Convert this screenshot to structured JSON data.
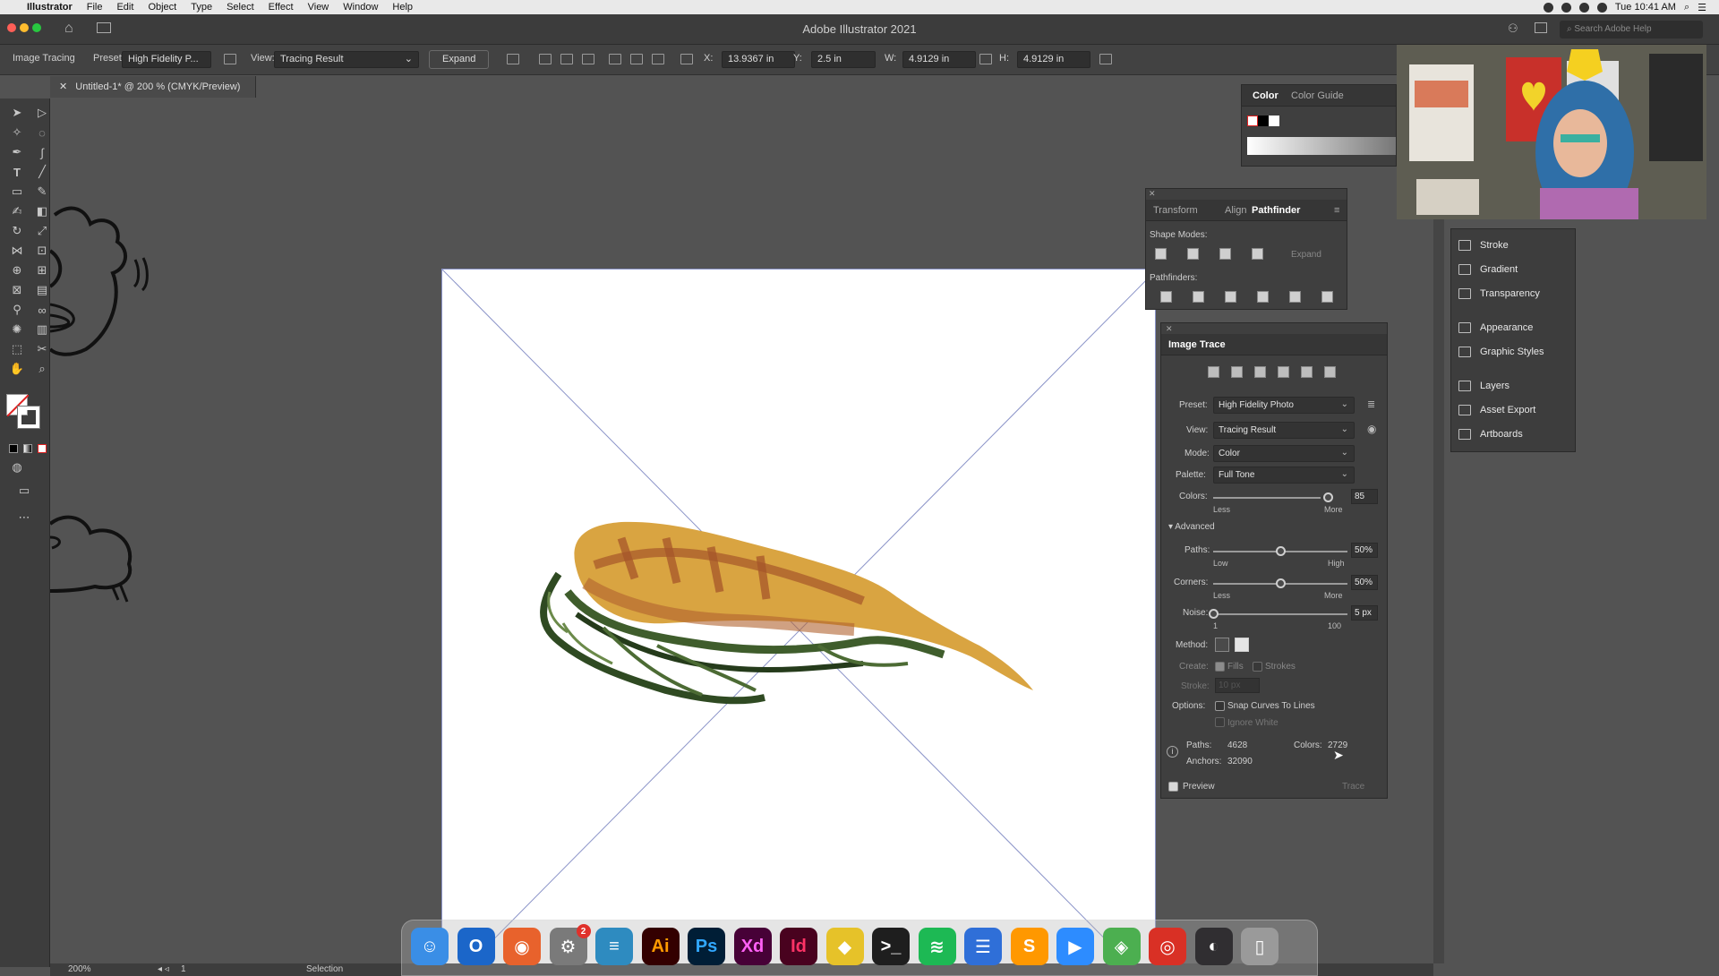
{
  "menubar": {
    "app_name": "Illustrator",
    "items": [
      "File",
      "Edit",
      "Object",
      "Type",
      "Select",
      "Effect",
      "View",
      "Window",
      "Help"
    ],
    "clock": "Tue 10:41 AM",
    "right_icons": [
      "dropbox-icon",
      "wifi-icon",
      "volume-icon",
      "battery-icon",
      "search-icon",
      "control-center-icon"
    ]
  },
  "window": {
    "title": "Adobe Illustrator 2021",
    "search_placeholder": "Search Adobe Help"
  },
  "controlbar": {
    "panel_label": "Image Tracing",
    "preset_label": "Preset:",
    "preset_value": "High Fidelity P...",
    "view_label": "View:",
    "view_value": "Tracing Result",
    "expand_label": "Expand",
    "x_label": "X:",
    "x_value": "13.9367 in",
    "y_label": "Y:",
    "y_value": "2.5 in",
    "w_label": "W:",
    "w_value": "4.9129 in",
    "h_label": "H:",
    "h_value": "4.9129 in"
  },
  "document_tab": {
    "title": "Untitled-1* @ 200 % (CMYK/Preview)",
    "close_glyph": "✕"
  },
  "statusbar": {
    "zoom": "200%",
    "artboard_number": "1",
    "tool_name": "Selection"
  },
  "color_panel": {
    "tabs": [
      "Color",
      "Color Guide"
    ]
  },
  "pathfinder_panel": {
    "tabs": [
      "Transform",
      "Align",
      "Pathfinder"
    ],
    "shape_modes_label": "Shape Modes:",
    "expand_label": "Expand",
    "pathfinders_label": "Pathfinders:"
  },
  "image_trace": {
    "title": "Image Trace",
    "preset_label": "Preset:",
    "preset_value": "High Fidelity Photo",
    "view_label": "View:",
    "view_value": "Tracing Result",
    "mode_label": "Mode:",
    "mode_value": "Color",
    "palette_label": "Palette:",
    "palette_value": "Full Tone",
    "colors_label": "Colors:",
    "colors_value": "85",
    "colors_fraction": 0.85,
    "colors_min_label": "Less",
    "colors_max_label": "More",
    "advanced_label": "Advanced",
    "paths_label": "Paths:",
    "paths_value": "50%",
    "paths_fraction": 0.5,
    "paths_min_label": "Low",
    "paths_max_label": "High",
    "corners_label": "Corners:",
    "corners_value": "50%",
    "corners_fraction": 0.5,
    "corners_min_label": "Less",
    "corners_max_label": "More",
    "noise_label": "Noise:",
    "noise_value": "5 px",
    "noise_fraction": 0.0,
    "noise_min_label": "1",
    "noise_max_label": "100",
    "method_label": "Method:",
    "create_label": "Create:",
    "fills_label": "Fills",
    "strokes_label": "Strokes",
    "stroke_label": "Stroke:",
    "stroke_value": "10 px",
    "options_label": "Options:",
    "snap_label": "Snap Curves To Lines",
    "ignore_white_label": "Ignore White",
    "stats_paths_label": "Paths:",
    "stats_paths_value": "4628",
    "stats_colors_label": "Colors:",
    "stats_colors_value": "2729",
    "stats_anchors_label": "Anchors:",
    "stats_anchors_value": "32090",
    "preview_label": "Preview",
    "trace_label": "Trace"
  },
  "side_panels": {
    "items": [
      "Stroke",
      "Gradient",
      "Transparency",
      "Appearance",
      "Graphic Styles",
      "Layers",
      "Asset Export",
      "Artboards"
    ]
  },
  "dock": {
    "apps": [
      {
        "name": "finder",
        "glyph": "☺",
        "color": "#3a8ee6"
      },
      {
        "name": "outlook",
        "glyph": "O",
        "color": "#1b66c9"
      },
      {
        "name": "firefox",
        "glyph": "◉",
        "color": "#e8622c"
      },
      {
        "name": "system-preferences",
        "glyph": "⚙",
        "color": "#7a7a7a",
        "badge": "2"
      },
      {
        "name": "notes",
        "glyph": "≡",
        "color": "#2e8bc0"
      },
      {
        "name": "illustrator",
        "glyph": "Ai",
        "color": "#330000",
        "fg": "#ff9a00"
      },
      {
        "name": "photoshop",
        "glyph": "Ps",
        "color": "#001e36",
        "fg": "#31a8ff"
      },
      {
        "name": "xd",
        "glyph": "Xd",
        "color": "#470137",
        "fg": "#ff61f6"
      },
      {
        "name": "indesign",
        "glyph": "Id",
        "color": "#49021f",
        "fg": "#ff3366"
      },
      {
        "name": "cyberduck",
        "glyph": "◆",
        "color": "#e6c229"
      },
      {
        "name": "terminal",
        "glyph": ">_",
        "color": "#1e1e1e"
      },
      {
        "name": "spotify",
        "glyph": "≋",
        "color": "#1db954"
      },
      {
        "name": "text-editor",
        "glyph": "☰",
        "color": "#2f6fd8"
      },
      {
        "name": "sublime",
        "glyph": "S",
        "color": "#ff9800"
      },
      {
        "name": "zoom",
        "glyph": "▶",
        "color": "#2d8cff"
      },
      {
        "name": "maps",
        "glyph": "◈",
        "color": "#4caf50"
      },
      {
        "name": "chrome",
        "glyph": "◎",
        "color": "#d93025"
      },
      {
        "name": "obs",
        "glyph": "◐",
        "color": "#302e31"
      },
      {
        "name": "trash",
        "glyph": "▯",
        "color": "#9a9a9a"
      }
    ]
  }
}
